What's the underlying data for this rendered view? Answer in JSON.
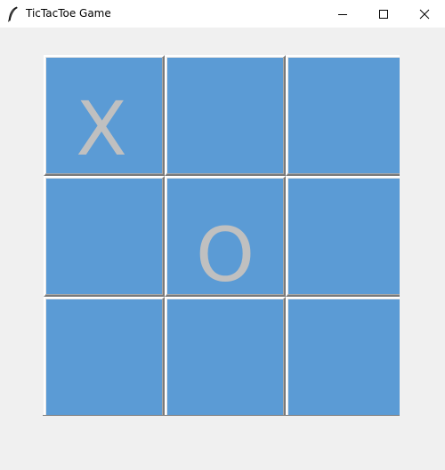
{
  "window": {
    "title": "TicTacToe Game",
    "icon": "feather-icon",
    "controls": [
      "minimize-icon",
      "maximize-icon",
      "close-icon"
    ]
  },
  "board": {
    "cells": [
      "X",
      "",
      "",
      "",
      "O",
      "",
      "",
      "",
      ""
    ],
    "cell_color": "#5b9bd5",
    "mark_color": "#c0c0c0"
  }
}
